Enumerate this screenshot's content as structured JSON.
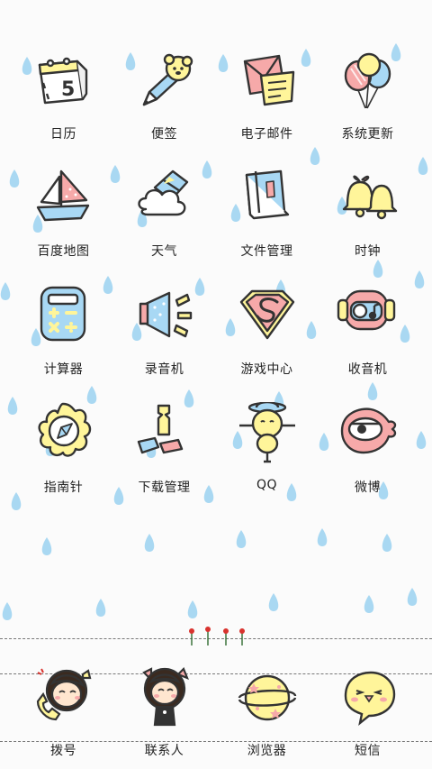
{
  "apps": [
    {
      "id": "calendar",
      "label": "日历",
      "icon": "calendar-icon"
    },
    {
      "id": "notes",
      "label": "便签",
      "icon": "pencil-icon"
    },
    {
      "id": "email",
      "label": "电子邮件",
      "icon": "envelope-icon"
    },
    {
      "id": "system-update",
      "label": "系统更新",
      "icon": "balloons-icon"
    },
    {
      "id": "baidu-map",
      "label": "百度地图",
      "icon": "sailboat-icon"
    },
    {
      "id": "weather",
      "label": "天气",
      "icon": "cloud-kite-icon"
    },
    {
      "id": "file-manager",
      "label": "文件管理",
      "icon": "book-icon"
    },
    {
      "id": "clock",
      "label": "时钟",
      "icon": "bells-icon"
    },
    {
      "id": "calculator",
      "label": "计算器",
      "icon": "calculator-icon"
    },
    {
      "id": "recorder",
      "label": "录音机",
      "icon": "megaphone-icon"
    },
    {
      "id": "game-center",
      "label": "游戏中心",
      "icon": "superman-badge-icon"
    },
    {
      "id": "radio",
      "label": "收音机",
      "icon": "radio-icon"
    },
    {
      "id": "compass",
      "label": "指南针",
      "icon": "compass-flower-icon"
    },
    {
      "id": "download-manager",
      "label": "下载管理",
      "icon": "tickets-icon"
    },
    {
      "id": "qq",
      "label": "QQ",
      "icon": "scarecrow-icon"
    },
    {
      "id": "weibo",
      "label": "微博",
      "icon": "eye-blob-icon"
    }
  ],
  "calendar_day": "5",
  "dock": [
    {
      "id": "dialer",
      "label": "拨号",
      "icon": "girl-phone-icon"
    },
    {
      "id": "contacts",
      "label": "联系人",
      "icon": "cat-girl-icon"
    },
    {
      "id": "browser",
      "label": "浏览器",
      "icon": "planet-icon"
    },
    {
      "id": "messages",
      "label": "短信",
      "icon": "chick-face-icon"
    }
  ],
  "colors": {
    "rain": "#a9d8f2",
    "outline": "#333333",
    "yellow": "#fff59a",
    "pink": "#f6a9a9",
    "blue": "#a8d8f4"
  }
}
